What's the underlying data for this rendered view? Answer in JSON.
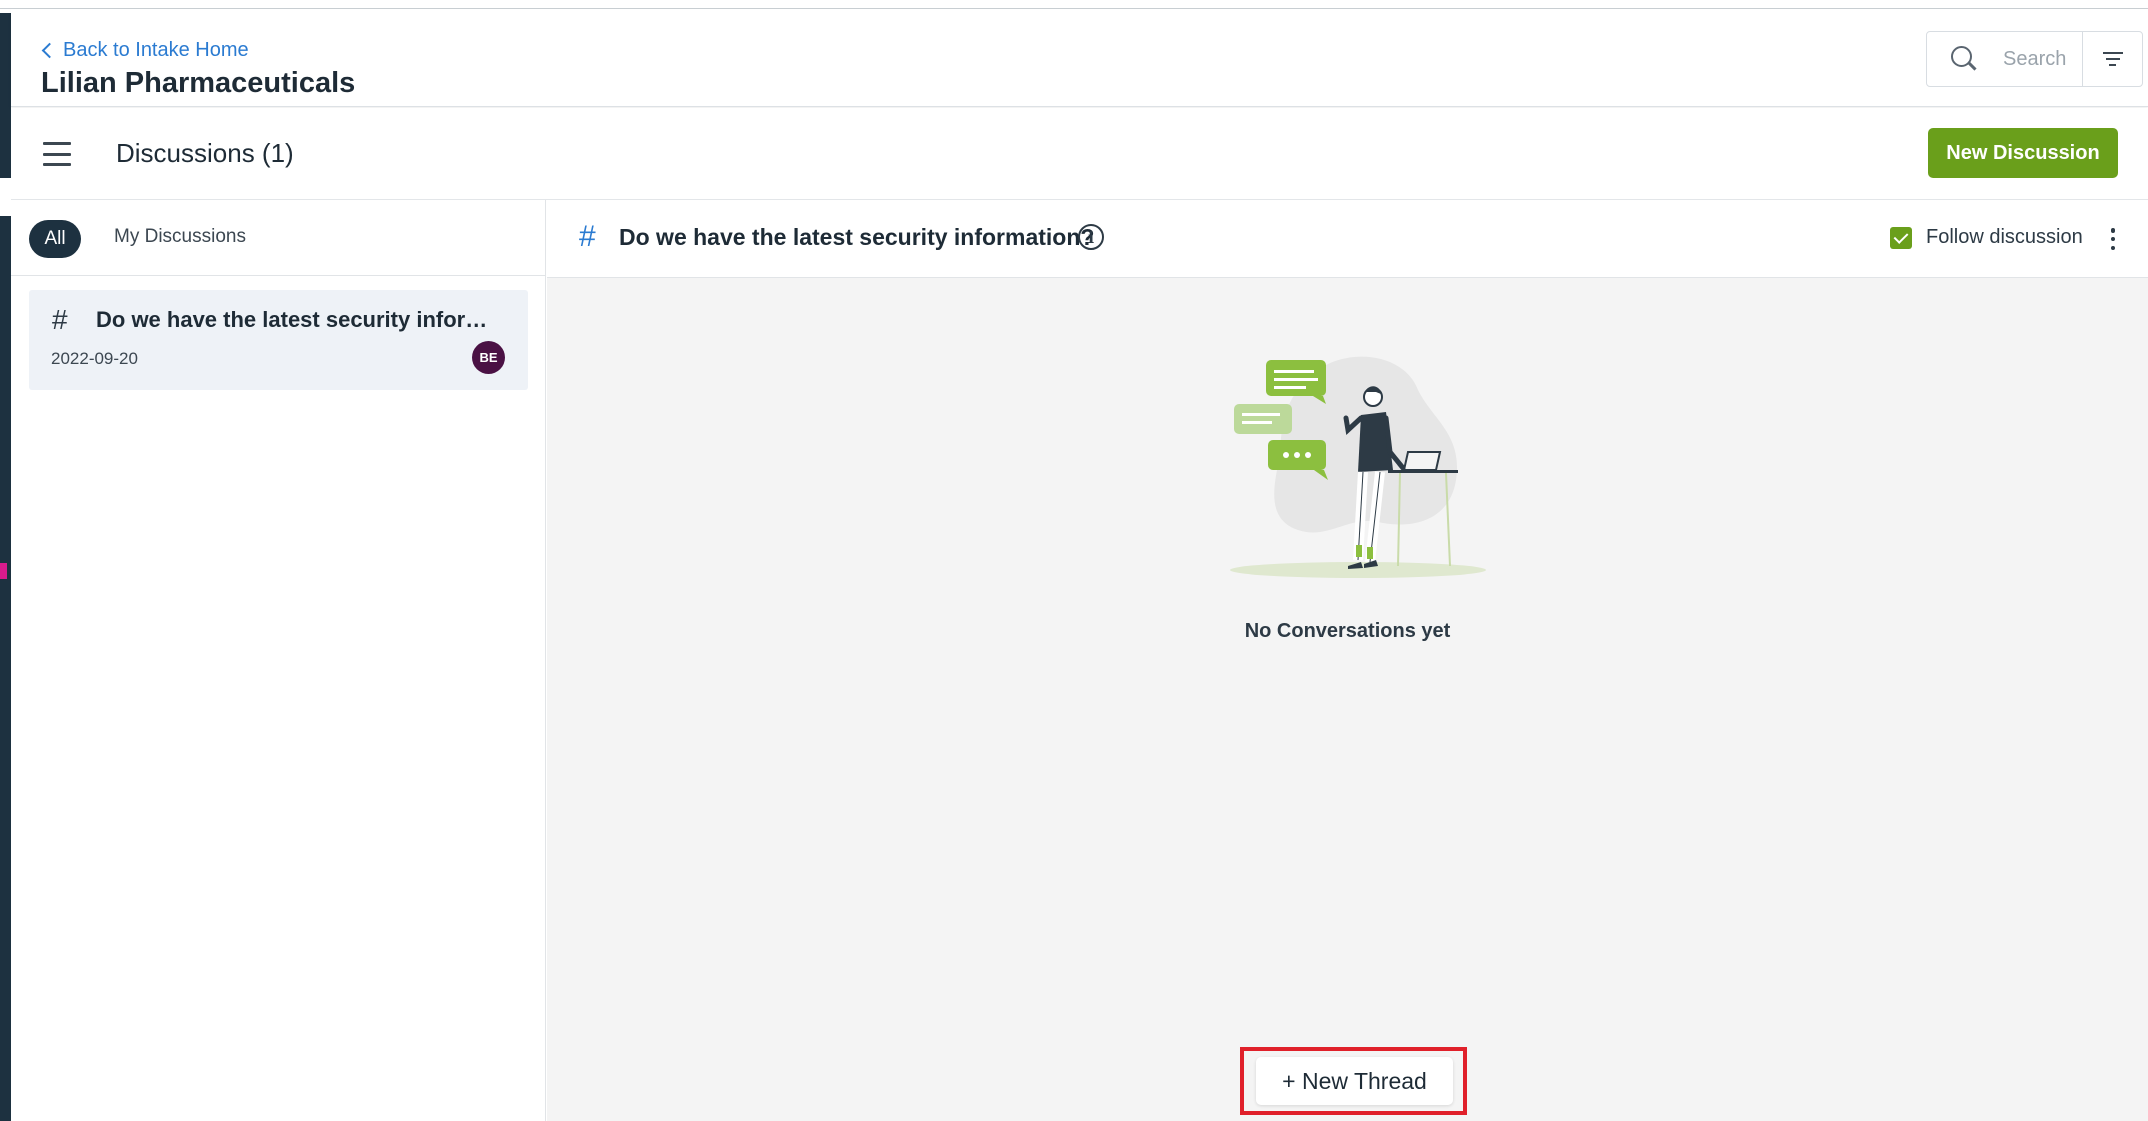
{
  "header": {
    "back_label": "Back to Intake Home",
    "org_name": "Lilian Pharmaceuticals",
    "search_placeholder": "Search"
  },
  "subbar": {
    "title": "Discussions (1)",
    "new_discussion_label": "New Discussion"
  },
  "list": {
    "tabs": [
      {
        "label": "All",
        "active": true
      },
      {
        "label": "My Discussions",
        "active": false
      }
    ],
    "items": [
      {
        "icon": "#",
        "title": "Do we have the latest security information?",
        "date": "2022-09-20",
        "avatar_initials": "BE",
        "avatar_color": "#4a1144"
      }
    ]
  },
  "detail": {
    "icon": "#",
    "title": "Do we have the latest security information?",
    "follow_label": "Follow discussion",
    "follow_checked": true,
    "empty_message": "No Conversations yet",
    "new_thread_label": "+ New Thread"
  },
  "colors": {
    "accent_green": "#6a9f1b",
    "link_blue": "#2b7bd1",
    "dark_navy": "#1d3140",
    "highlight_red": "#e0202a"
  }
}
